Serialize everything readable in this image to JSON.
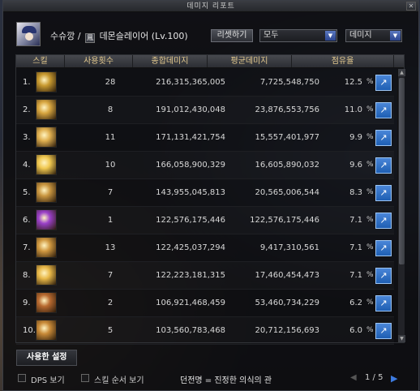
{
  "window": {
    "title": "데미지 리포트",
    "close_icon": "close-icon"
  },
  "character": {
    "name_prefix": "수슈깡 /",
    "class_icon": "class-icon",
    "class_icon_glyph": "鳳",
    "class_name": "데몬슬레이어 (Lv.100)"
  },
  "toolbar": {
    "reset_label": "리셋하기",
    "filter_value": "모두",
    "sort_value": "데미지"
  },
  "table": {
    "headers": [
      "스킬",
      "사용횟수",
      "종합데미지",
      "평균데미지",
      "점유율"
    ],
    "pct_symbol": "%",
    "rows": [
      {
        "rank": "1.",
        "casts": "28",
        "total": "216,315,365,005",
        "avg": "7,725,548,750",
        "share": "12.5",
        "icon_color": "#c89a30"
      },
      {
        "rank": "2.",
        "casts": "8",
        "total": "191,012,430,048",
        "avg": "23,876,553,756",
        "share": "11.0",
        "icon_color": "#d8a640"
      },
      {
        "rank": "3.",
        "casts": "11",
        "total": "171,131,421,754",
        "avg": "15,557,401,977",
        "share": "9.9",
        "icon_color": "#e0b050"
      },
      {
        "rank": "4.",
        "casts": "10",
        "total": "166,058,900,329",
        "avg": "16,605,890,032",
        "share": "9.6",
        "icon_color": "#f0c850"
      },
      {
        "rank": "5.",
        "casts": "7",
        "total": "143,955,045,813",
        "avg": "20,565,006,544",
        "share": "8.3",
        "icon_color": "#c99640"
      },
      {
        "rank": "6.",
        "casts": "1",
        "total": "122,576,175,446",
        "avg": "122,576,175,446",
        "share": "7.1",
        "icon_color": "#9a40c8"
      },
      {
        "rank": "7.",
        "casts": "13",
        "total": "122,425,037,294",
        "avg": "9,417,310,561",
        "share": "7.1",
        "icon_color": "#d09840"
      },
      {
        "rank": "8.",
        "casts": "7",
        "total": "122,223,181,315",
        "avg": "17,460,454,473",
        "share": "7.1",
        "icon_color": "#e8b848"
      },
      {
        "rank": "9.",
        "casts": "2",
        "total": "106,921,468,459",
        "avg": "53,460,734,229",
        "share": "6.2",
        "icon_color": "#b86a30"
      },
      {
        "rank": "10.",
        "casts": "5",
        "total": "103,560,783,468",
        "avg": "20,712,156,693",
        "share": "6.0",
        "icon_color": "#c88a38"
      }
    ]
  },
  "tabs": {
    "active_label": "사용한 설정"
  },
  "footer": {
    "dps_label": "DPS 보기",
    "order_label": "스킬 순서 보기",
    "title_text": "던전명 = 진정한 의식의 관",
    "pager_text": "1 / 5",
    "prev_glyph": "◀",
    "next_glyph": "▶"
  }
}
